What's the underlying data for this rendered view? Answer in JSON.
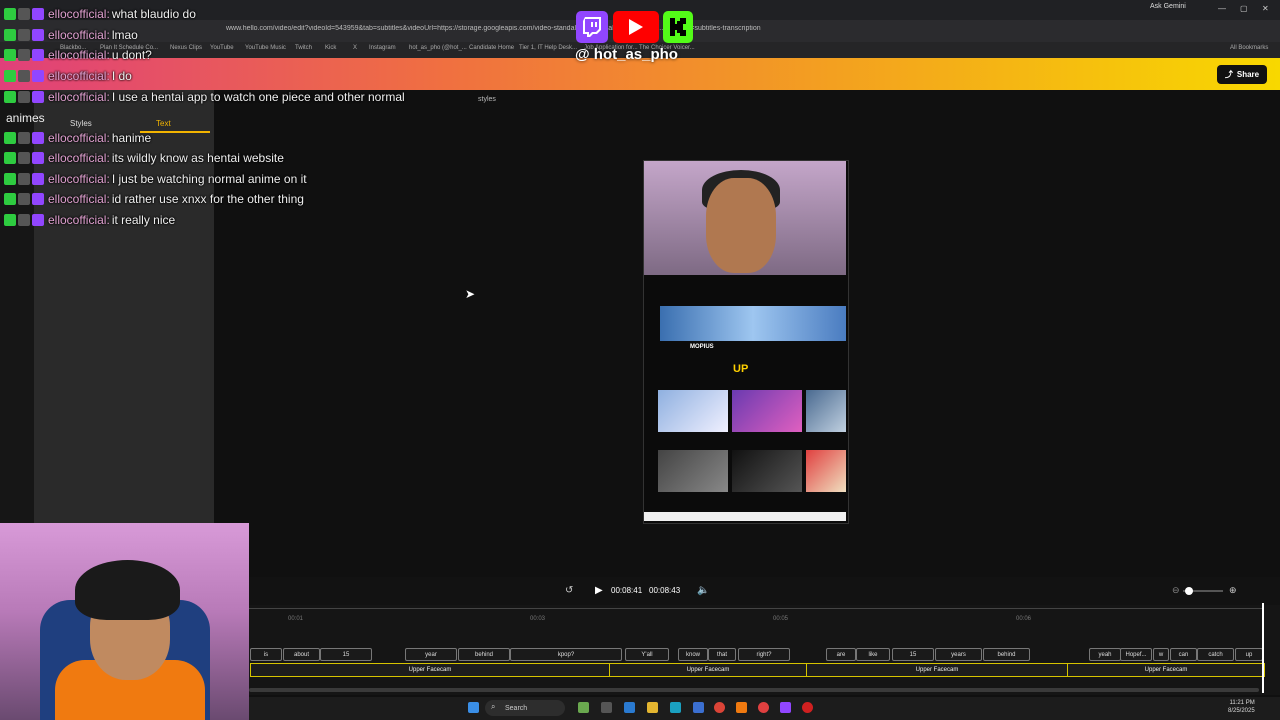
{
  "browser": {
    "url": "www.hello.com/video/edit?videoId=543959&tab=subtitles&videoUrl=https://storage.googleapis.com/video-standalone--normalize/770322/hc...&subTab=subtitles-transcription",
    "ask_gemini": "Ask Gemini",
    "bookmarks": [
      "Blackbo...",
      "Plan It Schedule Co...",
      "Nexus Clips",
      "YouTube",
      "YouTube Music",
      "Twitch",
      "Kick",
      "X",
      "Instagram",
      "hot_as_pho (@hot_...",
      "Candidate Home",
      "Tier 1, IT Help Desk...",
      "Job Application for...",
      "The Choicer Voicer...",
      "All Bookmarks"
    ]
  },
  "app": {
    "share_label": "Share",
    "left_panel": {
      "styles_tab": "Styles",
      "text_tab": "Text"
    },
    "styles_label": "styles"
  },
  "stream": {
    "handle": "@ hot_as_pho",
    "logos": [
      "twitch-icon",
      "youtube-icon",
      "kick-icon"
    ]
  },
  "chat": [
    {
      "user": "ellocofficial:",
      "message": "what blaudio do"
    },
    {
      "user": "ellocofficial:",
      "message": "lmao"
    },
    {
      "user": "ellocofficial:",
      "message": "u dont?"
    },
    {
      "user": "ellocofficial:",
      "message": "I do"
    },
    {
      "user": "ellocofficial:",
      "message": "I use a hentai app to watch one piece and other normal"
    },
    {
      "user": "",
      "message": "animes"
    },
    {
      "user": "ellocofficial:",
      "message": "hanime"
    },
    {
      "user": "ellocofficial:",
      "message": "its wildly know as hentai website"
    },
    {
      "user": "ellocofficial:",
      "message": "I just be watching normal anime on it"
    },
    {
      "user": "ellocofficial:",
      "message": "id rather use xnxx for the other thing"
    },
    {
      "user": "ellocofficial:",
      "message": "it really nice"
    }
  ],
  "preview": {
    "channel_name": "MOPIUS",
    "up_text": "UP"
  },
  "player": {
    "current_time": "00:08:41",
    "total_time": "00:08:43",
    "ticks": [
      "00:01",
      "00:03",
      "00:05",
      "00:06"
    ]
  },
  "timeline": {
    "words": [
      "is",
      "about",
      "15",
      "year",
      "behind",
      "kpop?",
      "Y'all",
      "know",
      "that",
      "right?",
      "are",
      "like",
      "15",
      "years",
      "behind",
      "yeah",
      "Hopef...",
      "w",
      "can",
      "catch",
      "up"
    ],
    "clips": [
      "Upper Facecam",
      "Upper Facecam",
      "Upper Facecam",
      "Upper Facecam"
    ]
  },
  "taskbar": {
    "search_label": "Search",
    "time": "11:21 PM",
    "date": "8/25/2025"
  }
}
